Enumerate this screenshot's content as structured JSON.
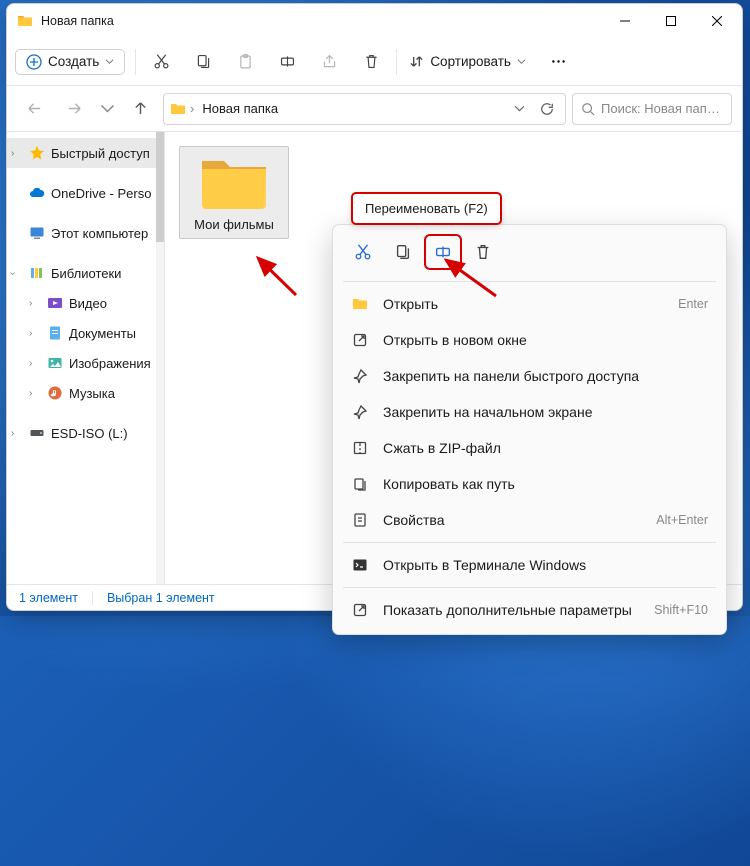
{
  "window": {
    "title": "Новая папка"
  },
  "toolbar": {
    "create_label": "Создать",
    "sort_label": "Сортировать"
  },
  "breadcrumb": {
    "current": "Новая папка"
  },
  "search": {
    "placeholder": "Поиск: Новая пап…"
  },
  "sidebar": {
    "quick_access": "Быстрый доступ",
    "onedrive": "OneDrive - Perso",
    "this_pc": "Этот компьютер",
    "libraries": "Библиотеки",
    "video": "Видео",
    "documents": "Документы",
    "pictures": "Изображения",
    "music": "Музыка",
    "drive": "ESD-ISO (L:)"
  },
  "content": {
    "folder_name": "Мои фильмы"
  },
  "status": {
    "count": "1 элемент",
    "selected": "Выбран 1 элемент"
  },
  "tooltip": {
    "text": "Переименовать (F2)"
  },
  "ctx": {
    "open": "Открыть",
    "open_key": "Enter",
    "open_new": "Открыть в новом окне",
    "pin_quick": "Закрепить на панели быстрого доступа",
    "pin_start": "Закрепить на начальном экране",
    "zip": "Сжать в ZIP-файл",
    "copy_path": "Копировать как путь",
    "properties": "Свойства",
    "properties_key": "Alt+Enter",
    "terminal": "Открыть в Терминале Windows",
    "more": "Показать дополнительные параметры",
    "more_key": "Shift+F10"
  },
  "icons": {
    "folder_yellow": "#ffc83d",
    "folder_yellow_dark": "#e8a93a",
    "onedrive": "#0078d4",
    "star": "#ffb900"
  }
}
